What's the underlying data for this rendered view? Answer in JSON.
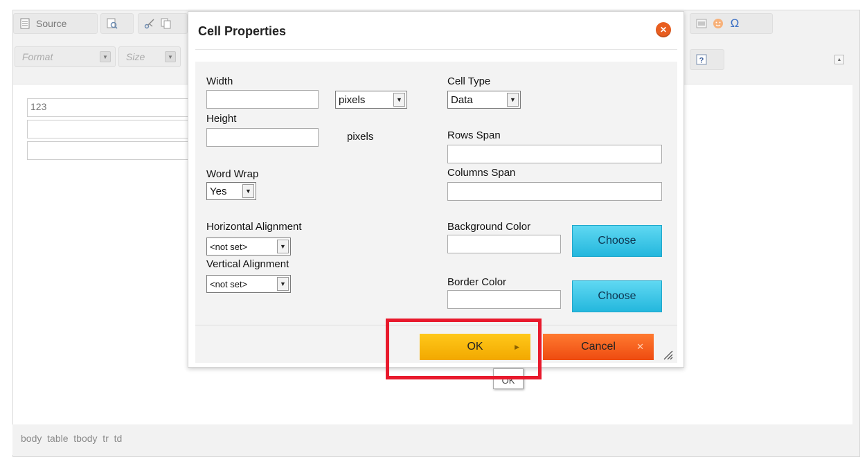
{
  "toolbar": {
    "source_label": "Source",
    "format_placeholder": "Format",
    "size_placeholder": "Size"
  },
  "editor": {
    "cells": [
      "123",
      "",
      ""
    ]
  },
  "status": {
    "path": "body  table  tbody  tr  td"
  },
  "dialog": {
    "title": "Cell Properties",
    "width_label": "Width",
    "width_unit": "pixels",
    "height_label": "Height",
    "height_unit": "pixels",
    "word_wrap_label": "Word Wrap",
    "word_wrap_value": "Yes",
    "h_align_label": "Horizontal Alignment",
    "h_align_value": "<not set>",
    "v_align_label": "Vertical Alignment",
    "v_align_value": "<not set>",
    "cell_type_label": "Cell Type",
    "cell_type_value": "Data",
    "rows_span_label": "Rows Span",
    "columns_span_label": "Columns Span",
    "bg_color_label": "Background Color",
    "border_color_label": "Border Color",
    "choose_label": "Choose",
    "ok_label": "OK",
    "cancel_label": "Cancel"
  },
  "tooltip": {
    "text": "OK"
  },
  "colors": {
    "accent_ok": "#f5b400",
    "accent_cancel": "#ee5a1a",
    "choose_button": "#3cc6e8",
    "highlight_box": "#e8192c"
  }
}
